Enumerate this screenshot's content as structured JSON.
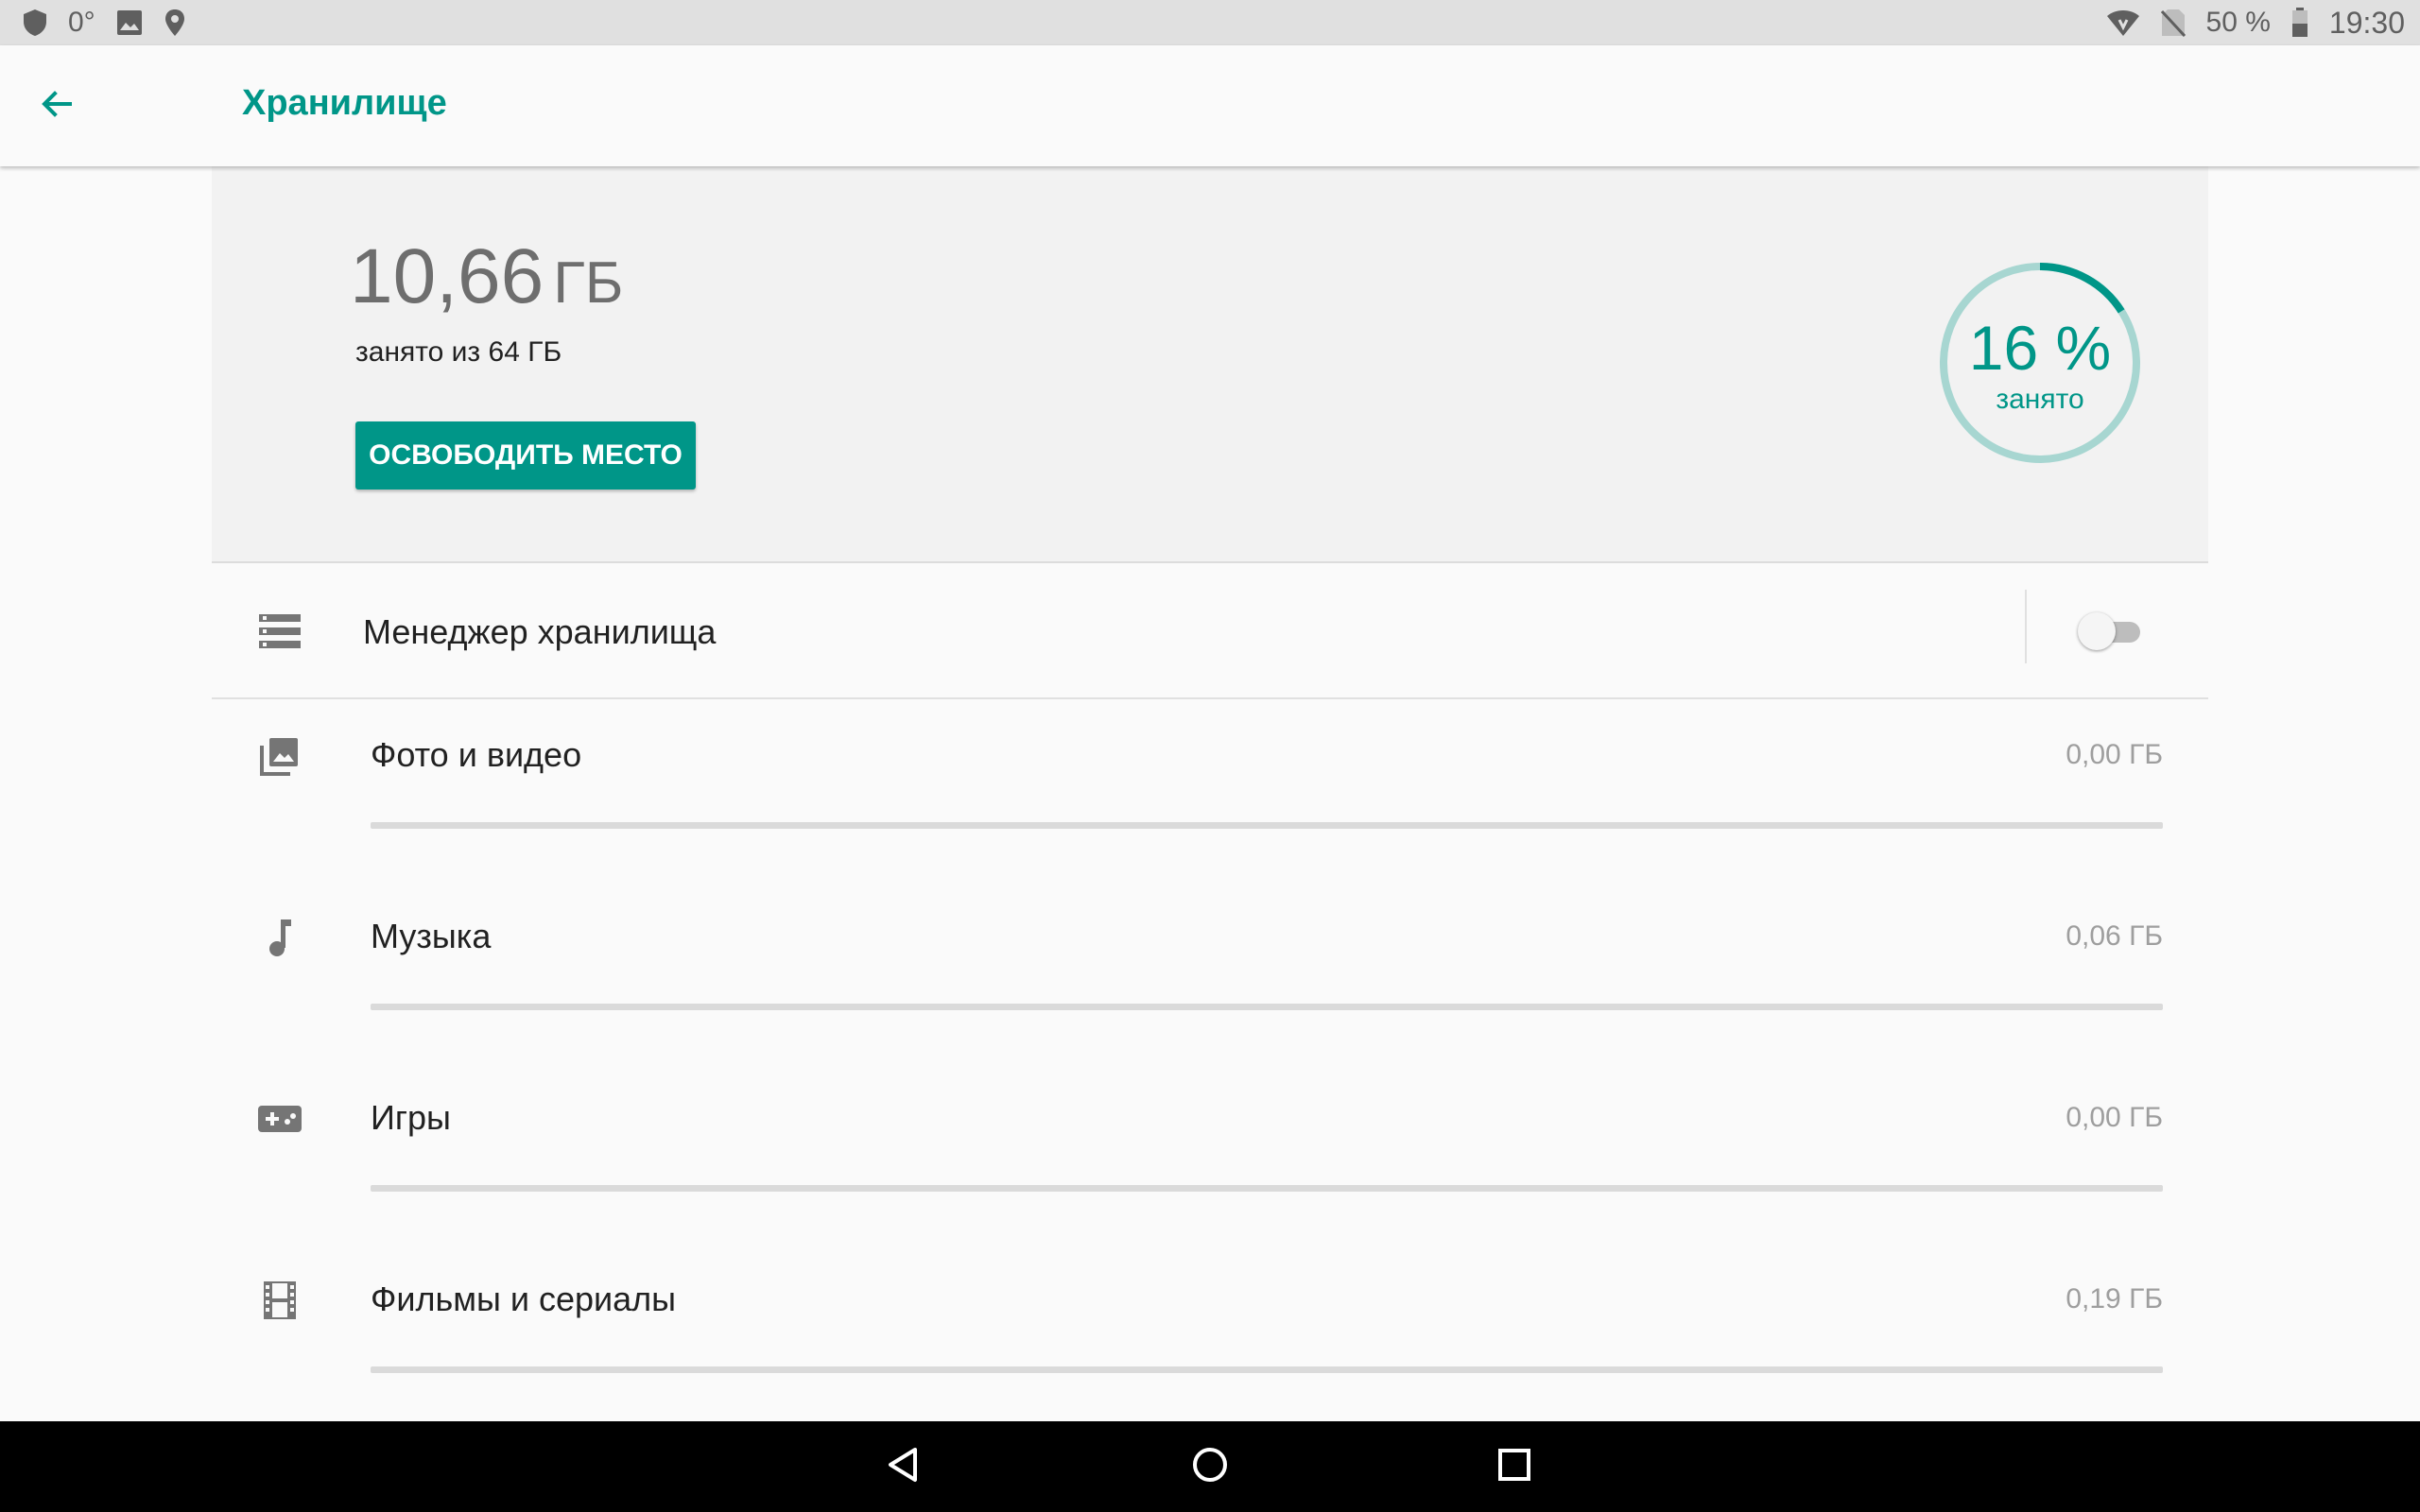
{
  "status_bar": {
    "left_icons": [
      "shield-icon",
      "weather-icon",
      "image-icon",
      "location-icon"
    ],
    "temperature": "0°",
    "right_icons": [
      "wifi-icon",
      "no-sim-icon",
      "battery-icon"
    ],
    "battery": "50 %",
    "time": "19:30"
  },
  "toolbar": {
    "back_icon": "arrow-left-icon",
    "title": "Хранилище"
  },
  "summary": {
    "used_value": "10,66",
    "used_unit": "ГБ",
    "used_description": "занято из 64 ГБ",
    "free_button_label": "ОСВОБОДИТЬ МЕСТО",
    "donut_percent": "16 %",
    "donut_label": "занято",
    "donut_fraction": 0.16
  },
  "manager": {
    "icon": "storage-list-icon",
    "label": "Менеджер хранилища",
    "enabled": false
  },
  "categories": [
    {
      "icon": "photo-library-icon",
      "label": "Фото и видео",
      "size": "0,00 ГБ",
      "fraction": 0.0
    },
    {
      "icon": "music-note-icon",
      "label": "Музыка",
      "size": "0,06 ГБ",
      "fraction": 0.0
    },
    {
      "icon": "gamepad-icon",
      "label": "Игры",
      "size": "0,00 ГБ",
      "fraction": 0.0
    },
    {
      "icon": "movie-film-icon",
      "label": "Фильмы и сериалы",
      "size": "0,19 ГБ",
      "fraction": 0.0
    }
  ],
  "nav_bar": {
    "back": "nav-back-icon",
    "home": "nav-home-icon",
    "recents": "nav-recents-icon"
  },
  "colors": {
    "accent": "#009688",
    "donut_track": "#a7d6d1",
    "status_bar_bg": "#e0e0e0",
    "summary_bg": "#f2f2f2"
  }
}
